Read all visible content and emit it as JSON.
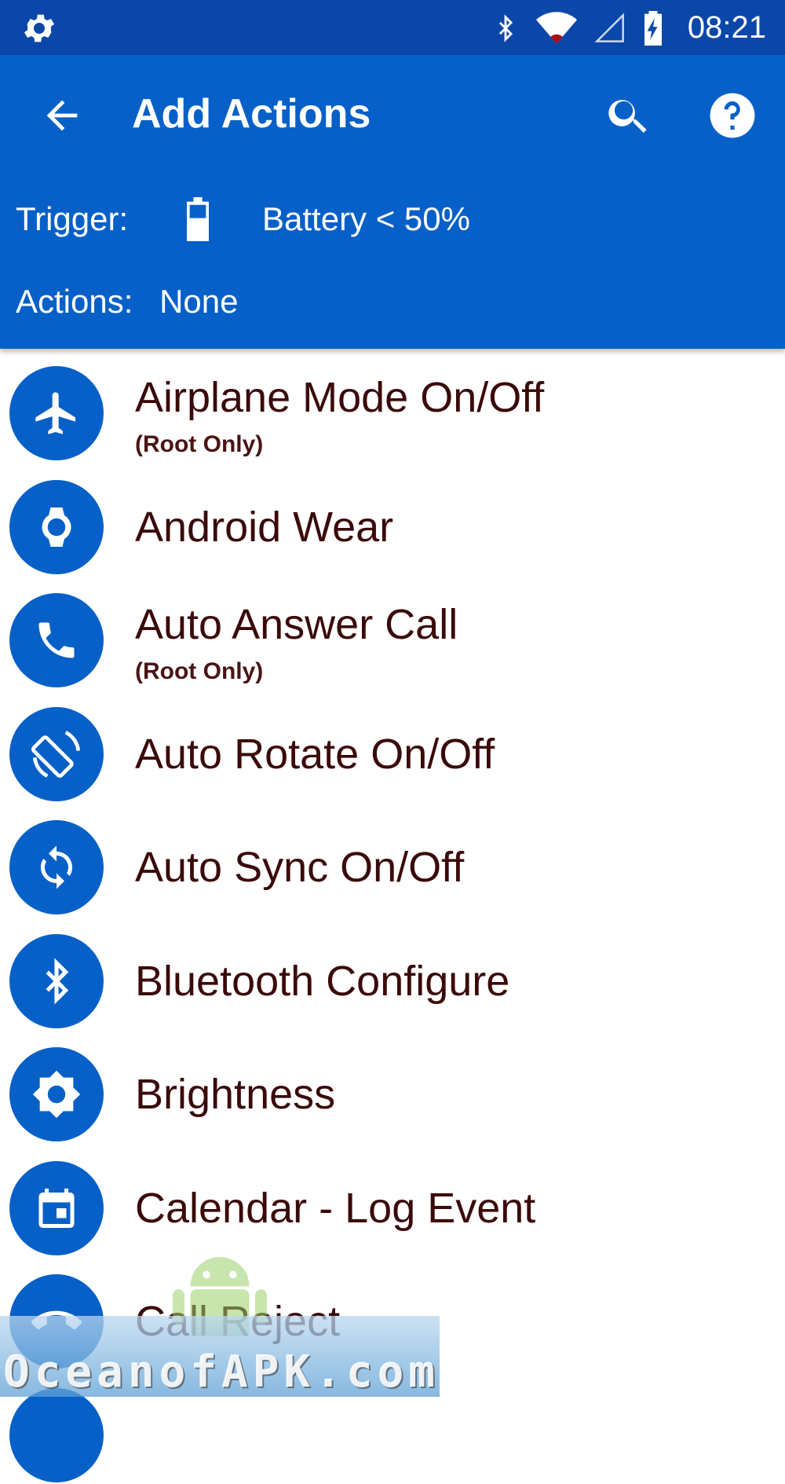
{
  "status_bar": {
    "time": "08:21",
    "icons": [
      "gear-icon",
      "bluetooth-icon",
      "wifi-icon",
      "cell-signal-icon",
      "battery-charging-icon"
    ]
  },
  "app_bar": {
    "title": "Add Actions",
    "back_icon": "arrow-back-icon",
    "search_icon": "search-icon",
    "help_icon": "help-icon",
    "trigger_label": "Trigger:",
    "trigger_icon": "battery-icon",
    "trigger_value": "Battery < 50%",
    "actions_label": "Actions:",
    "actions_value": "None"
  },
  "colors": {
    "status_bar": "#0a47a9",
    "primary": "#0760c7",
    "item_text": "#3b0a0a"
  },
  "actions": [
    {
      "label": "Airplane Mode On/Off",
      "sub": "(Root Only)",
      "icon": "airplane-icon"
    },
    {
      "label": "Android Wear",
      "icon": "watch-icon"
    },
    {
      "label": "Auto Answer Call",
      "sub": "(Root Only)",
      "icon": "phone-icon"
    },
    {
      "label": "Auto Rotate On/Off",
      "icon": "screen-rotation-icon"
    },
    {
      "label": "Auto Sync On/Off",
      "icon": "sync-icon"
    },
    {
      "label": "Bluetooth Configure",
      "icon": "bluetooth-icon"
    },
    {
      "label": "Brightness",
      "icon": "brightness-icon"
    },
    {
      "label": "Calendar - Log Event",
      "icon": "calendar-icon"
    },
    {
      "label": "Call Reject",
      "icon": "call-end-icon"
    }
  ],
  "watermark": {
    "text": "OceanofAPK.com",
    "badge": "APK"
  }
}
